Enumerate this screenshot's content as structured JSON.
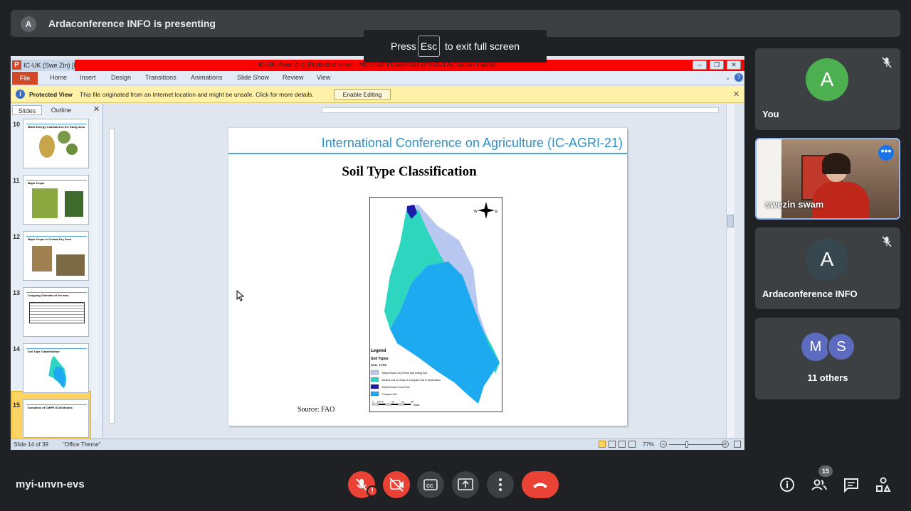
{
  "top_bar": {
    "presenter_initial": "A",
    "presenting_text": "Ardaconference INFO is presenting"
  },
  "fullscreen_toast": {
    "press": "Press",
    "key": "Esc",
    "after": "to exit full screen"
  },
  "powerpoint": {
    "tab_title": "IC-UK (Swe Zin) [I",
    "window_title": "IC-UK (Swe Zin) [Protected View]  -  Microsoft PowerPoint (Product Activation Failed)",
    "ribbon_tabs": [
      "File",
      "Home",
      "Insert",
      "Design",
      "Transitions",
      "Animations",
      "Slide Show",
      "Review",
      "View"
    ],
    "protected_view": {
      "label": "Protected View",
      "message": "This file originated from an Internet location and might be unsafe. Click for more details.",
      "button": "Enable Editing"
    },
    "pane_tabs": [
      "Slides",
      "Outline"
    ],
    "thumbnails": [
      {
        "num": "10",
        "title": "Maize Energy Cultivated in the Study Area"
      },
      {
        "num": "11",
        "title": "Major Crops"
      },
      {
        "num": "12",
        "title": "Major Crops in Central Dry Zone"
      },
      {
        "num": "13",
        "title": "Cropping Calendar of the area"
      },
      {
        "num": "14",
        "title": "Soil Type Classification"
      },
      {
        "num": "15",
        "title": "Scenarios of CMIP5 GCM Models"
      }
    ],
    "slide": {
      "header": "International Conference on Agriculture (IC-AGRI-21)",
      "title": "Soil Type Classification",
      "source": "Source: FAO",
      "map": {
        "legend_title": "Legend",
        "legend_subtitle": "Soil Types",
        "legend_field": "SOIL_TYPE",
        "legend_items": [
          {
            "label": "Yellow Brown Dry Forest and Inding Soil",
            "color": "#b8c8f0"
          },
          {
            "label": "Savana Soil on Slope & Compact Soil in Depression",
            "color": "#2ed6c0"
          },
          {
            "label": "Yellow Brown Forest Soil",
            "color": "#1c1ca8"
          },
          {
            "label": "Compact Soil",
            "color": "#1eaaf0"
          }
        ],
        "scale_labels": [
          "0",
          "2.5",
          "5",
          "10",
          "15",
          "20"
        ],
        "scale_unit": "Miles"
      }
    },
    "status": {
      "slide_count": "Slide 14 of 39",
      "theme": "\"Office Theme\"",
      "zoom": "77%"
    }
  },
  "participants": [
    {
      "name": "You",
      "initial": "A",
      "avatar_color": "#4caf50"
    },
    {
      "name": "swezin swam"
    },
    {
      "name": "Ardaconference INFO",
      "initial": "A",
      "avatar_color": "#37474f"
    },
    {
      "name": "11 others",
      "initials": [
        "M",
        "S"
      ],
      "avatar_color": "#5c6bc0"
    }
  ],
  "meeting": {
    "code": "myi-unvn-evs",
    "people_count": "15"
  }
}
